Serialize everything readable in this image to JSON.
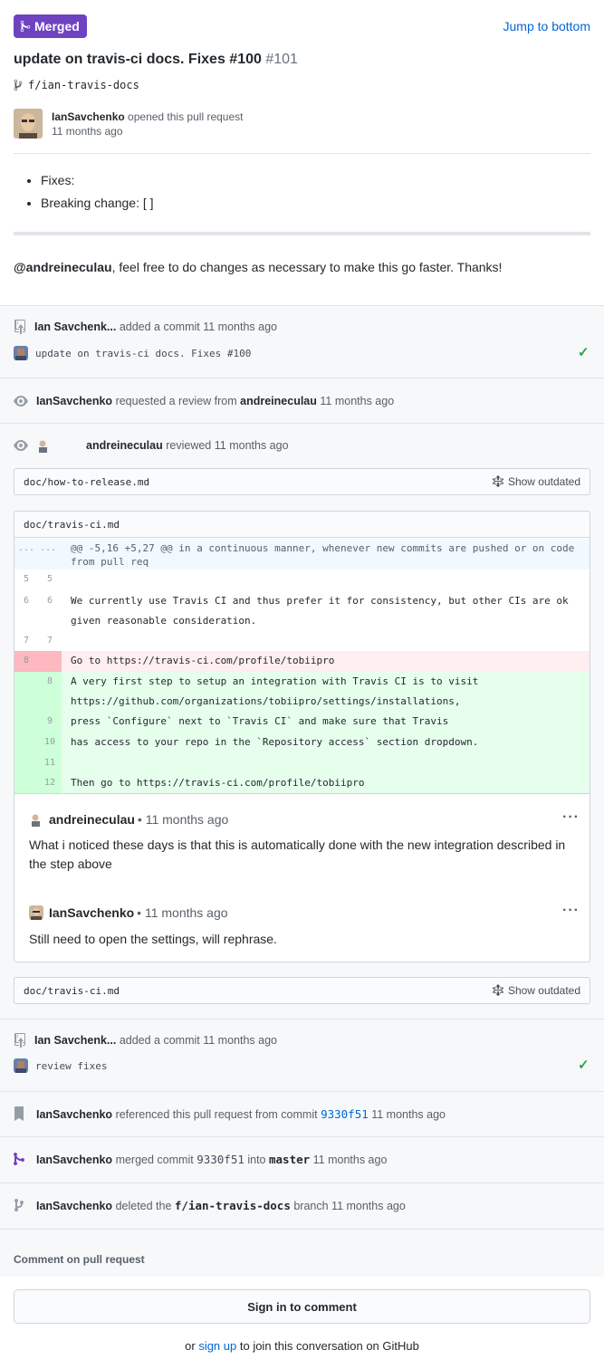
{
  "header": {
    "badge": "Merged",
    "jump": "Jump to bottom",
    "title": "update on travis-ci docs. Fixes #100",
    "number": "#101",
    "branch": "f/ian-travis-docs"
  },
  "opener": {
    "user": "IanSavchenko",
    "action": "opened this pull request",
    "time": "11 months ago"
  },
  "body": {
    "items": [
      "Fixes:",
      "Breaking change: [ ]"
    ],
    "mention": "@andreineculau",
    "text": ", feel free to do changes as necessary to make this go faster. Thanks!"
  },
  "events": {
    "commit1": {
      "user": "Ian Savchenk...",
      "action": "added a commit",
      "time": "11 months ago",
      "message": "update on travis-ci docs. Fixes #100"
    },
    "review_request": {
      "user": "IanSavchenko",
      "action": "requested a review from",
      "reviewer": "andreineculau",
      "time": "11 months ago"
    },
    "reviewed": {
      "user": "andreineculau",
      "action": "reviewed",
      "time": "11 months ago"
    },
    "commit2": {
      "user": "Ian Savchenk...",
      "action": "added a commit",
      "time": "11 months ago",
      "message": "review fixes"
    },
    "referenced": {
      "user": "IanSavchenko",
      "action": "referenced this pull request from commit",
      "sha": "9330f51",
      "time": "11 months ago"
    },
    "merged": {
      "user": "IanSavchenko",
      "action": "merged commit",
      "sha": "9330f51",
      "into": "into",
      "target": "master",
      "time": "11 months ago"
    },
    "deleted": {
      "user": "IanSavchenko",
      "action": "deleted the",
      "branch": "f/ian-travis-docs",
      "suffix": "branch",
      "time": "11 months ago"
    }
  },
  "files": {
    "file1": "doc/how-to-release.md",
    "file2": "doc/travis-ci.md",
    "file3": "doc/travis-ci.md",
    "show_outdated": "Show outdated"
  },
  "diff": {
    "hunk_gutter": "... ...",
    "hunk": "@@ -5,16 +5,27 @@ in a continuous manner, whenever new commits are pushed or on code from pull req",
    "lines": [
      {
        "old": "5",
        "new": "5",
        "code": ""
      },
      {
        "old": "6",
        "new": "6",
        "code": "We currently use Travis CI and thus prefer it for consistency, but other CIs are ok given reasonable consideration."
      },
      {
        "old": "7",
        "new": "7",
        "code": ""
      },
      {
        "old": "8",
        "new": "",
        "code": "Go to https://travis-ci.com/profile/tobiipro"
      },
      {
        "old": "",
        "new": "8",
        "code": "A very first step to setup an integration with Travis CI is to visit https://github.com/organizations/tobiipro/settings/installations,"
      },
      {
        "old": "",
        "new": "9",
        "code": "press `Configure` next to `Travis CI` and make sure that Travis"
      },
      {
        "old": "",
        "new": "10",
        "code": "has access to your repo in the `Repository access` section dropdown."
      },
      {
        "old": "",
        "new": "11",
        "code": ""
      },
      {
        "old": "",
        "new": "12",
        "code": "Then go to https://travis-ci.com/profile/tobiipro"
      }
    ]
  },
  "comments": [
    {
      "user": "andreineculau",
      "time": "• 11 months ago",
      "body": "What i noticed these days is that this is automatically done with the new integration described in the step above"
    },
    {
      "user": "IanSavchenko",
      "time": "• 11 months ago",
      "body": "Still need to open the settings, will rephrase."
    }
  ],
  "footer": {
    "label": "Comment on pull request",
    "signin": "Sign in to comment",
    "or": "or",
    "signup": "sign up",
    "rest": "to join this conversation on GitHub"
  },
  "colors": {
    "merged": "#6f42c1",
    "link": "#0366d6",
    "success": "#28a745"
  }
}
